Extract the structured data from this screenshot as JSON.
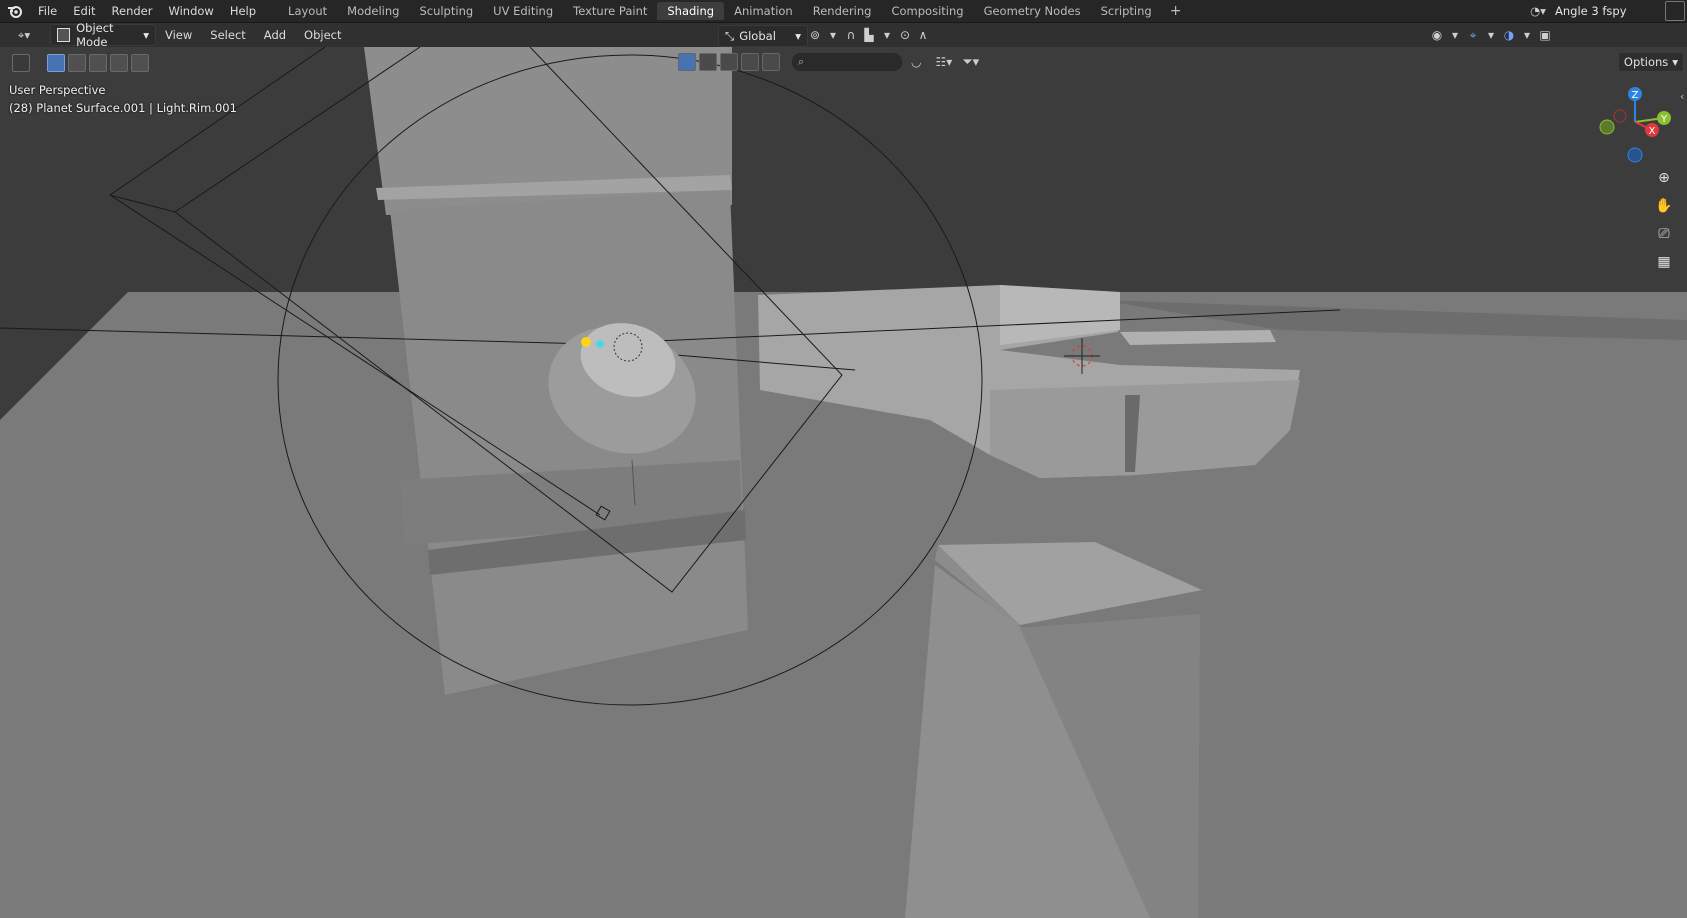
{
  "topbar": {
    "menus": [
      "File",
      "Edit",
      "Render",
      "Window",
      "Help"
    ],
    "workspaces": [
      "Layout",
      "Modeling",
      "Sculpting",
      "UV Editing",
      "Texture Paint",
      "Shading",
      "Animation",
      "Rendering",
      "Compositing",
      "Geometry Nodes",
      "Scripting"
    ],
    "active_workspace": "Shading",
    "add_workspace": "+",
    "scene_name": "Angle 3 fspy"
  },
  "header": {
    "mode": "Object Mode",
    "menus": [
      "View",
      "Select",
      "Add",
      "Object"
    ],
    "transform_orientation": "Global",
    "options_label": "Options"
  },
  "viewport": {
    "view_name": "User Perspective",
    "active_info": "(28) Planet Surface.001 | Light.Rim.001",
    "gizmo_axes": {
      "z": "Z",
      "y": "Y",
      "x": "X"
    },
    "axis_colors": {
      "x": "#e0383f",
      "y": "#8bbf2f",
      "z": "#2f83e0"
    },
    "background": "#3f3f3f"
  },
  "icons": {
    "logo": "blender-logo-icon",
    "zoom": "zoom-icon",
    "pan": "hand-icon",
    "camera": "camera-icon",
    "grid": "ortho-grid-icon"
  }
}
